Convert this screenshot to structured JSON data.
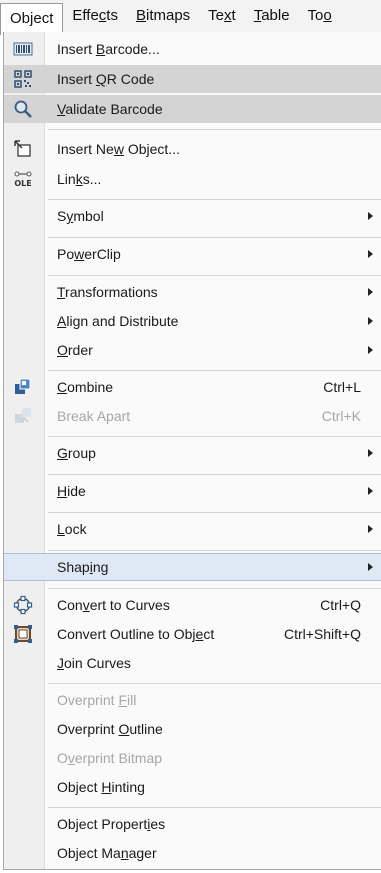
{
  "menubar": {
    "items": [
      {
        "label": "Object",
        "u": 2
      },
      {
        "label": "Effects",
        "u": 4
      },
      {
        "label": "Bitmaps",
        "u": 0
      },
      {
        "label": "Text",
        "u": 2
      },
      {
        "label": "Table",
        "u": 0
      },
      {
        "label": "Too",
        "u": 2
      }
    ]
  },
  "menu": {
    "items": [
      {
        "label": "Insert Barcode...",
        "u": 7,
        "icon": "barcode-icon"
      },
      {
        "label": "Insert QR Code",
        "u": 7,
        "icon": "qr-code-icon",
        "state": "highlighted"
      },
      {
        "label": "Validate Barcode",
        "u": 0,
        "icon": "magnifier-icon",
        "state": "highlighted"
      },
      {
        "label": "Insert New Object...",
        "u": 9,
        "icon": "insert-object-icon"
      },
      {
        "label": "Links...",
        "u": 3,
        "icon": "ole-icon"
      },
      {
        "label": "Symbol",
        "u": 1,
        "submenu": true
      },
      {
        "label": "PowerClip",
        "u": 2,
        "submenu": true
      },
      {
        "label": "Transformations",
        "u": 0,
        "submenu": true
      },
      {
        "label": "Align and Distribute",
        "u": 0,
        "submenu": true
      },
      {
        "label": "Order",
        "u": 0,
        "submenu": true
      },
      {
        "label": "Combine",
        "u": 0,
        "icon": "combine-icon",
        "shortcut": "Ctrl+L"
      },
      {
        "label": "Break Apart",
        "u": -1,
        "icon": "break-apart-icon",
        "shortcut": "Ctrl+K",
        "disabled": true
      },
      {
        "label": "Group",
        "u": 0,
        "submenu": true
      },
      {
        "label": "Hide",
        "u": 0,
        "submenu": true
      },
      {
        "label": "Lock",
        "u": 0,
        "submenu": true
      },
      {
        "label": "Shaping",
        "u": 4,
        "submenu": true,
        "state": "selected"
      },
      {
        "label": "Convert to Curves",
        "u": 3,
        "icon": "convert-curves-icon",
        "shortcut": "Ctrl+Q"
      },
      {
        "label": "Convert Outline to Object",
        "u": 22,
        "icon": "outline-object-icon",
        "shortcut": "Ctrl+Shift+Q"
      },
      {
        "label": "Join Curves",
        "u": 0
      },
      {
        "label": "Overprint Fill",
        "u": 10,
        "disabled": true
      },
      {
        "label": "Overprint Outline",
        "u": 10
      },
      {
        "label": "Overprint Bitmap",
        "u": 1,
        "disabled": true
      },
      {
        "label": "Object Hinting",
        "u": 7
      },
      {
        "label": "Object Properties",
        "u": 14
      },
      {
        "label": "Object Manager",
        "u": 9
      }
    ]
  },
  "colors": {
    "highlight": "#d4d4d4",
    "selected": "#dfe9f5",
    "disabled_text": "#a6a6a6",
    "icon_blue": "#2f5f93"
  }
}
